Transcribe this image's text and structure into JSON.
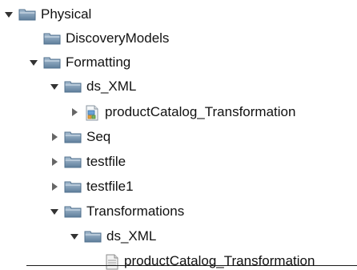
{
  "tree": {
    "physical": {
      "label": "Physical",
      "icon": "folder-icon",
      "expanded": true
    },
    "discovery_models": {
      "label": "DiscoveryModels",
      "icon": "folder-icon",
      "expanded": false
    },
    "formatting": {
      "label": "Formatting",
      "icon": "folder-icon",
      "expanded": true
    },
    "ds_xml_1": {
      "label": "ds_XML",
      "icon": "folder-icon",
      "expanded": true
    },
    "product_catalog_1": {
      "label": "productCatalog_Transformation",
      "icon": "schema-file-icon",
      "expanded": false
    },
    "seq": {
      "label": "Seq",
      "icon": "folder-icon",
      "expanded": false
    },
    "testfile": {
      "label": "testfile",
      "icon": "folder-icon",
      "expanded": false
    },
    "testfile1": {
      "label": "testfile1",
      "icon": "folder-icon",
      "expanded": false
    },
    "transformations": {
      "label": "Transformations",
      "icon": "folder-icon",
      "expanded": true
    },
    "ds_xml_2": {
      "label": "ds_XML",
      "icon": "folder-icon",
      "expanded": true
    },
    "product_catalog_2": {
      "label": "productCatalog_Transformation",
      "icon": "document-icon",
      "expanded": false
    }
  },
  "colors": {
    "folder_fill": "#6f8fab",
    "folder_light": "#9bb3c8",
    "folder_dark": "#4f6f8c",
    "arrow": "#333333",
    "text": "#111111"
  }
}
